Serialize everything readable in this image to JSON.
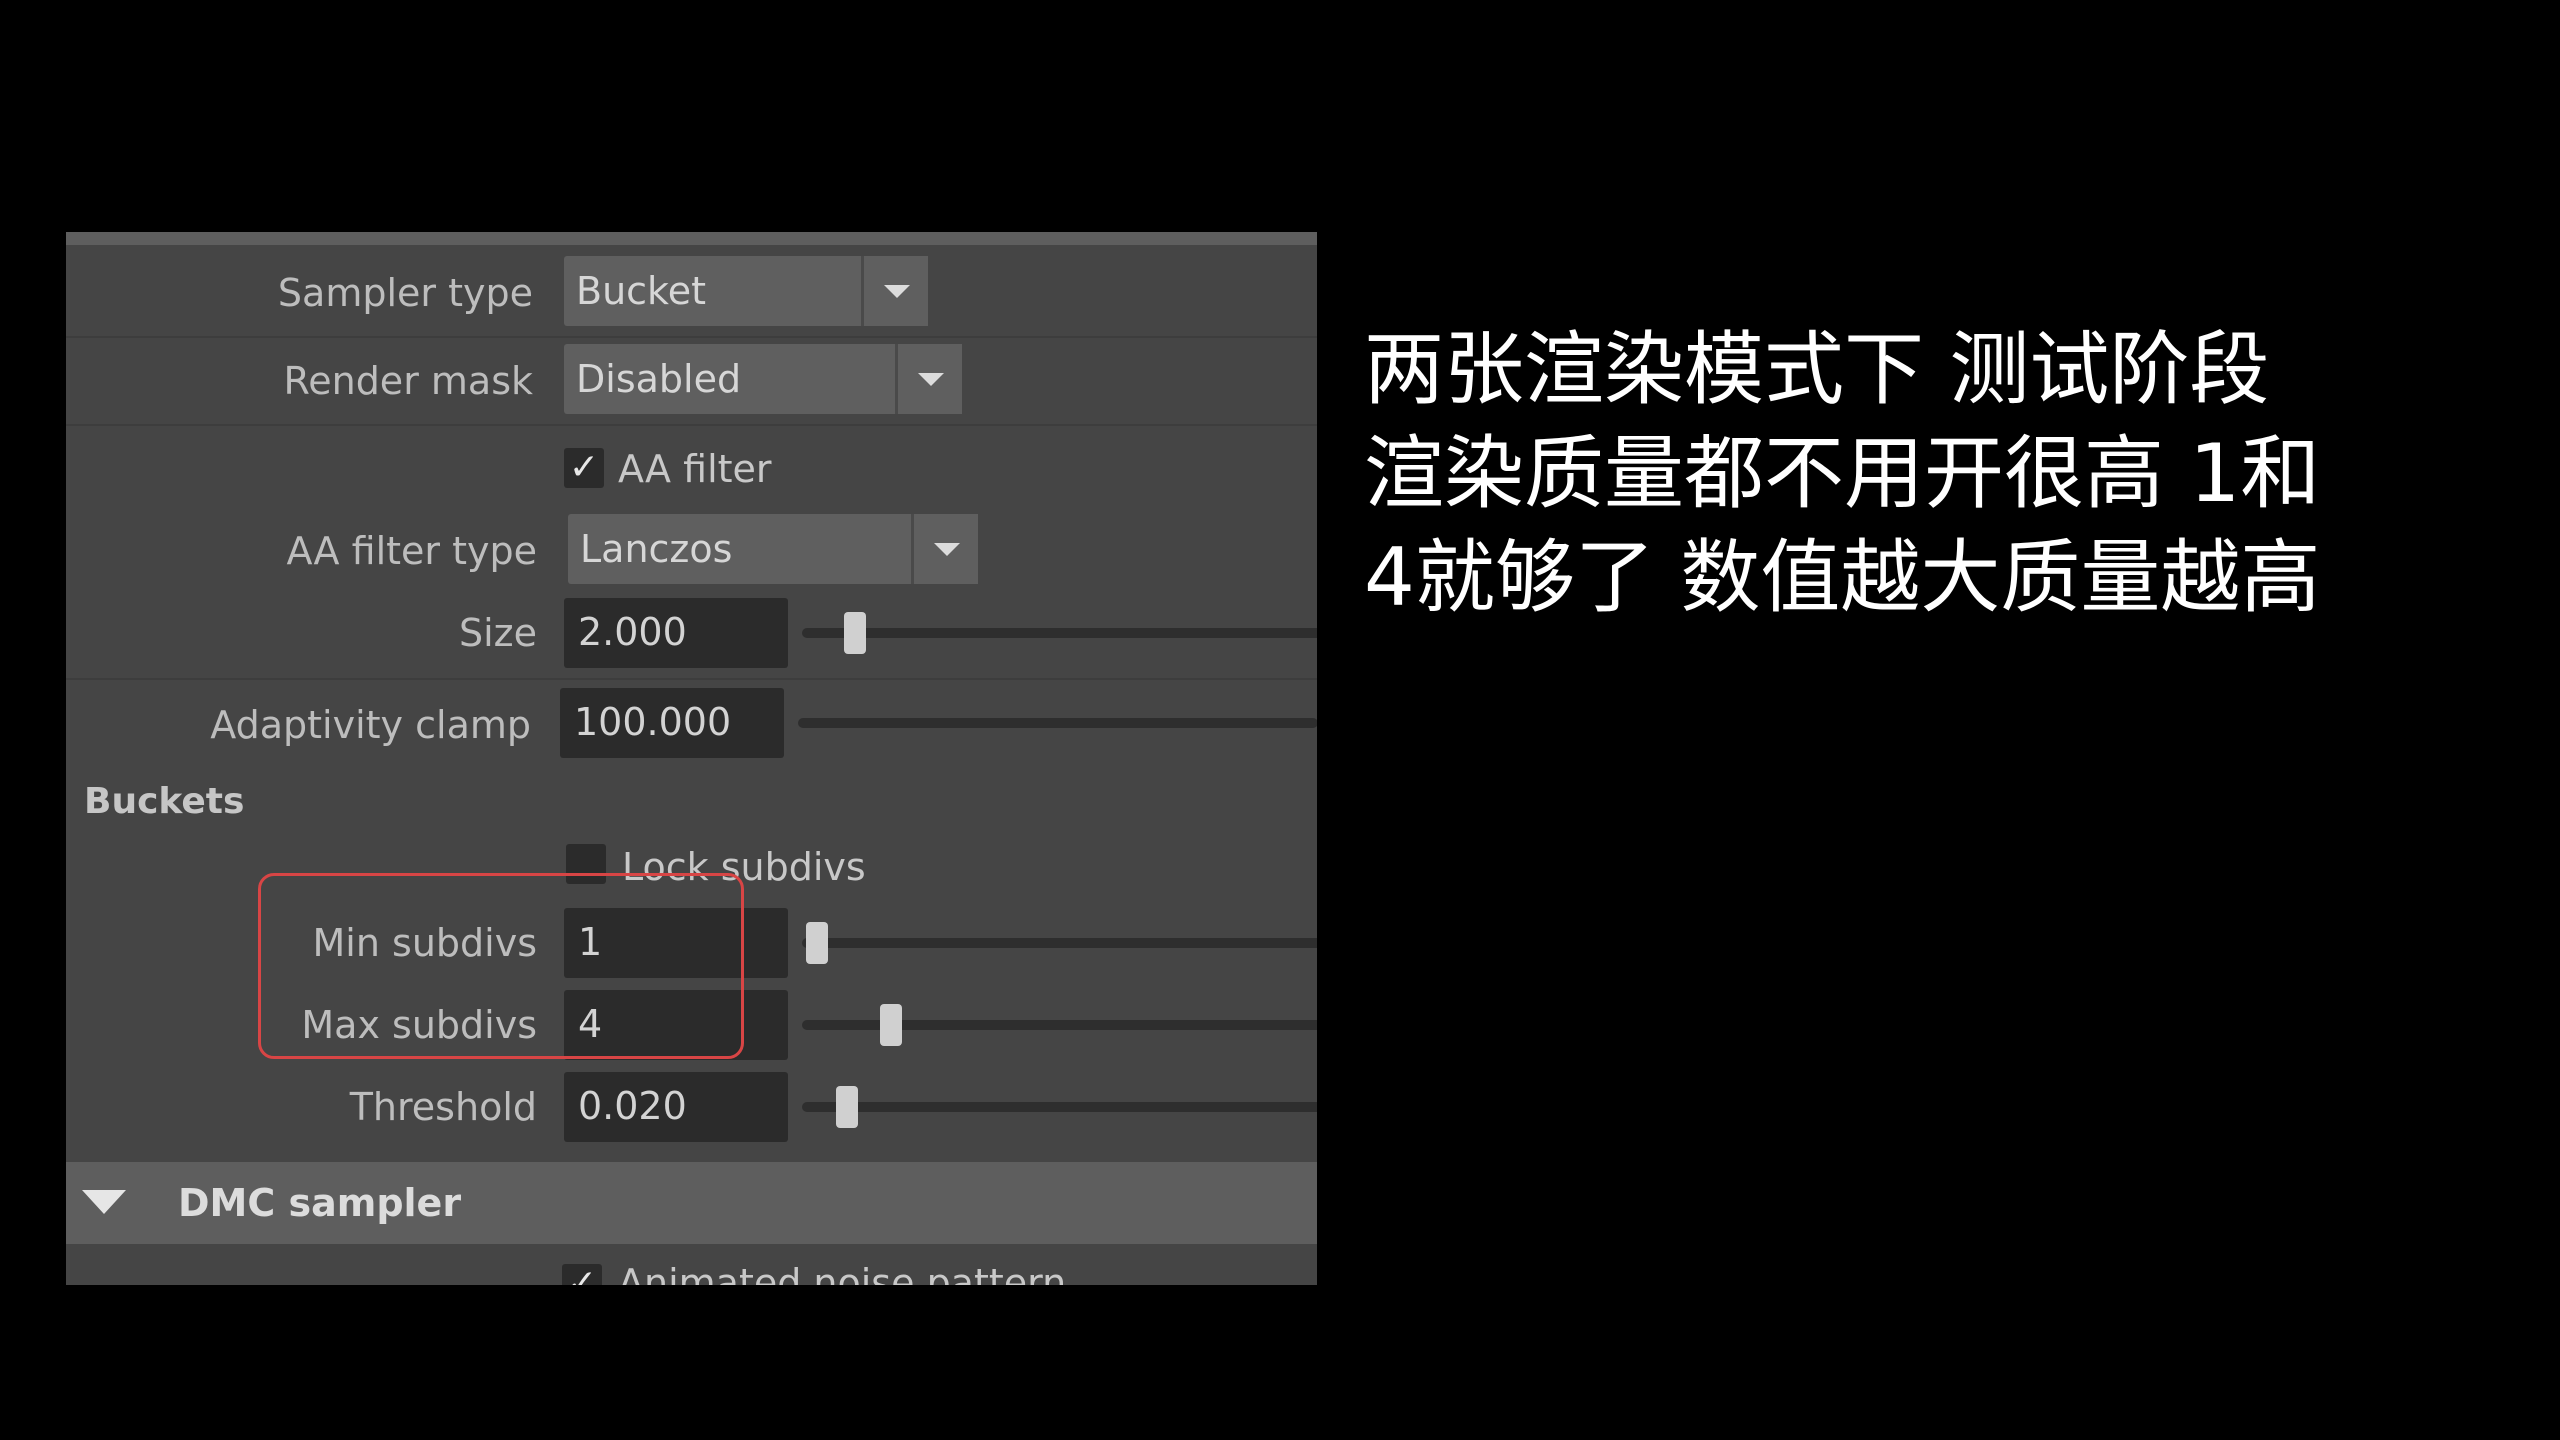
{
  "settings": {
    "sampler_type": {
      "label": "Sampler type",
      "value": "Bucket"
    },
    "render_mask": {
      "label": "Render mask",
      "value": "Disabled"
    },
    "aa_filter": {
      "label": "AA filter",
      "checked": true
    },
    "aa_filter_type": {
      "label": "AA filter type",
      "value": "Lanczos"
    },
    "size": {
      "label": "Size",
      "value": "2.000",
      "slider_fraction": 0.06
    },
    "adaptivity_clamp": {
      "label": "Adaptivity clamp",
      "value": "100.000"
    },
    "buckets_heading": "Buckets",
    "lock_subdivs": {
      "label": "Lock subdivs",
      "checked": false
    },
    "min_subdivs": {
      "label": "Min subdivs",
      "value": "1",
      "slider_fraction": 0.01
    },
    "max_subdivs": {
      "label": "Max subdivs",
      "value": "4",
      "slider_fraction": 0.1
    },
    "threshold": {
      "label": "Threshold",
      "value": "0.020",
      "slider_fraction": 0.05
    },
    "dmc_sampler": {
      "label": "DMC sampler",
      "expanded": true
    },
    "animated_noise_pattern": {
      "label": "Animated noise pattern",
      "checked": true
    }
  },
  "caption": {
    "line1": "两张渲染模式下 测试阶段",
    "line2": "渲染质量都不用开很高 1和",
    "line3": "4就够了 数值越大质量越高"
  },
  "colors": {
    "highlight": "#d84545",
    "panel_bg": "#454545",
    "background": "#000000"
  }
}
